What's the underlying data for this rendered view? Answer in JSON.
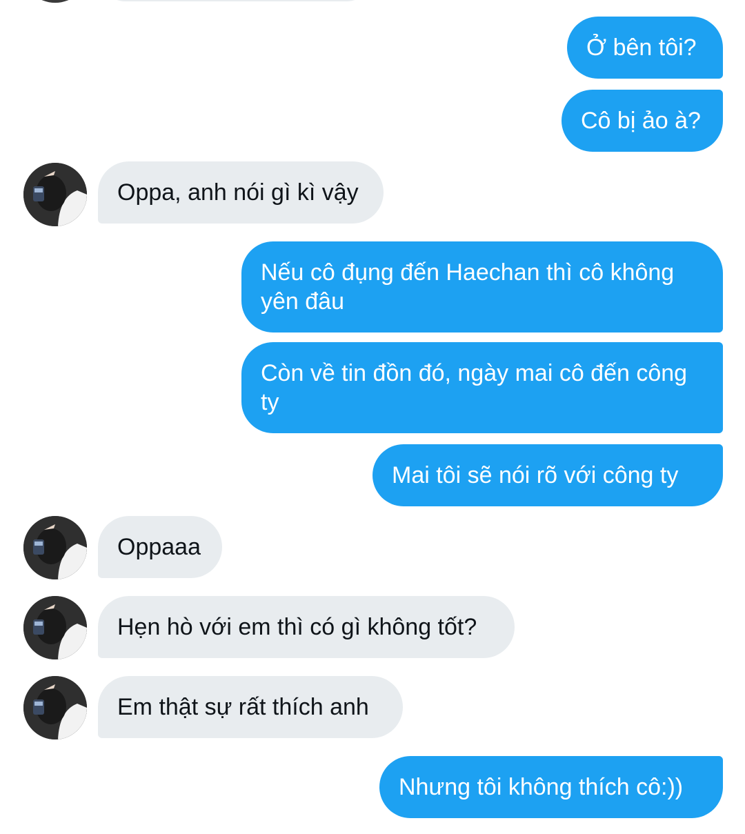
{
  "messages": [
    {
      "side": "sent",
      "text": "Ở bên tôi?"
    },
    {
      "side": "sent",
      "text": "Cô bị ảo à?"
    },
    {
      "side": "received",
      "text": "Oppa, anh nói gì kì vậy"
    },
    {
      "side": "sent",
      "text": "Nếu cô đụng đến Haechan thì cô không yên đâu"
    },
    {
      "side": "sent",
      "text": "Còn về tin đồn đó, ngày mai cô đến công ty"
    },
    {
      "side": "sent",
      "text": "Mai tôi sẽ nói rõ với công ty"
    },
    {
      "side": "received",
      "text": "Oppaaa"
    },
    {
      "side": "received",
      "text": "Hẹn hò với em thì có gì không tốt?"
    },
    {
      "side": "received",
      "text": "Em thật sự rất thích anh"
    },
    {
      "side": "sent",
      "text": "Nhưng tôi không thích cô:))"
    }
  ],
  "colors": {
    "sent_bubble": "#1da1f2",
    "received_bubble": "#e8ecef",
    "sent_text": "#ffffff",
    "received_text": "#0f1419"
  },
  "avatar": {
    "icon": "user-avatar-photo"
  }
}
